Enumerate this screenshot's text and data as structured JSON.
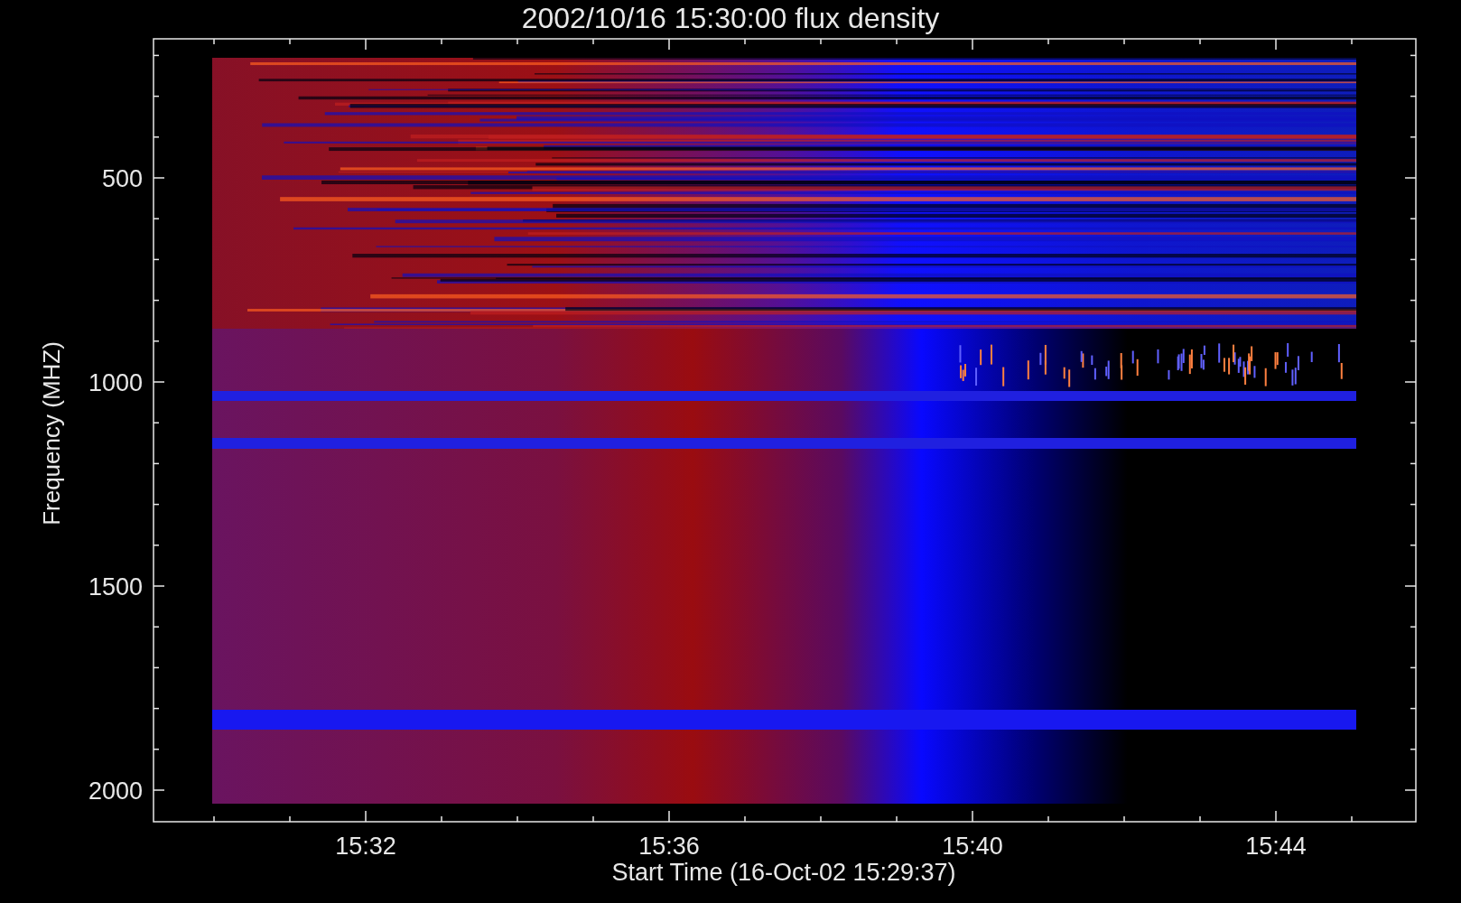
{
  "title": "2002/10/16 15:30:00 flux density",
  "y_axis": {
    "label": "Frequency (MHZ)",
    "ticks": [
      "500",
      "1000",
      "1500",
      "2000"
    ]
  },
  "x_axis": {
    "label": "Start Time (16-Oct-02 15:29:37)",
    "ticks": [
      "15:32",
      "15:36",
      "15:40",
      "15:44"
    ]
  }
}
